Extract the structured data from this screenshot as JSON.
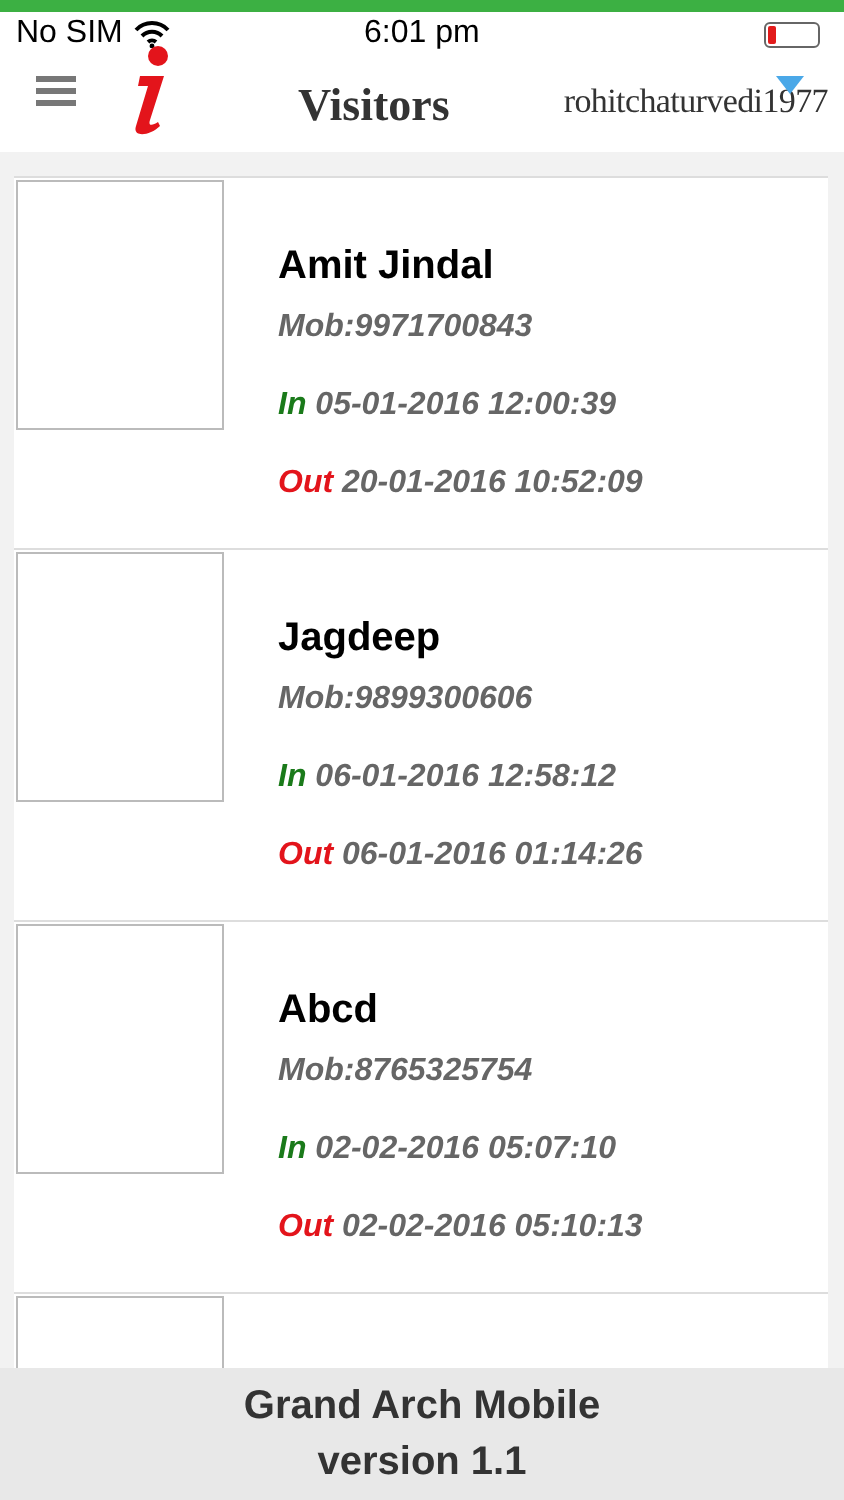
{
  "status_bar": {
    "carrier": "No SIM",
    "time": "6:01 pm"
  },
  "header": {
    "title": "Visitors",
    "user": "rohitchaturvedi1977"
  },
  "visitors": [
    {
      "name": "Amit Jindal",
      "mobile": "Mob:9971700843",
      "in_label": "In",
      "in_time": "05-01-2016 12:00:39",
      "out_label": "Out",
      "out_time": "20-01-2016 10:52:09"
    },
    {
      "name": "Jagdeep",
      "mobile": "Mob:9899300606",
      "in_label": "In",
      "in_time": "06-01-2016 12:58:12",
      "out_label": "Out",
      "out_time": "06-01-2016 01:14:26"
    },
    {
      "name": "Abcd",
      "mobile": "Mob:8765325754",
      "in_label": "In",
      "in_time": "02-02-2016 05:07:10",
      "out_label": "Out",
      "out_time": "02-02-2016 05:10:13"
    }
  ],
  "footer": {
    "line_1": "Grand Arch Mobile",
    "line_2": "version 1.1"
  }
}
